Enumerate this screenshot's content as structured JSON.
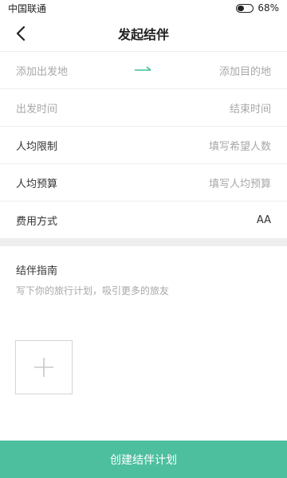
{
  "status_bar": {
    "carrier": "中国联通",
    "battery": "68%"
  },
  "nav": {
    "title": "发起结伴"
  },
  "route": {
    "origin_placeholder": "添加出发地",
    "destination_placeholder": "添加目的地"
  },
  "time": {
    "start_placeholder": "出发时间",
    "end_placeholder": "结束时间"
  },
  "people": {
    "label": "人均限制",
    "placeholder": "填写希望人数"
  },
  "budget": {
    "label": "人均预算",
    "placeholder": "填写人均预算"
  },
  "payment": {
    "label": "费用方式",
    "value": "AA"
  },
  "guide": {
    "title": "结伴指南",
    "placeholder": "写下你的旅行计划，吸引更多的旅友"
  },
  "footer": {
    "button_label": "创建结伴计划"
  },
  "colors": {
    "accent": "#4dbf9f",
    "arrow": "#3dbd9a"
  }
}
